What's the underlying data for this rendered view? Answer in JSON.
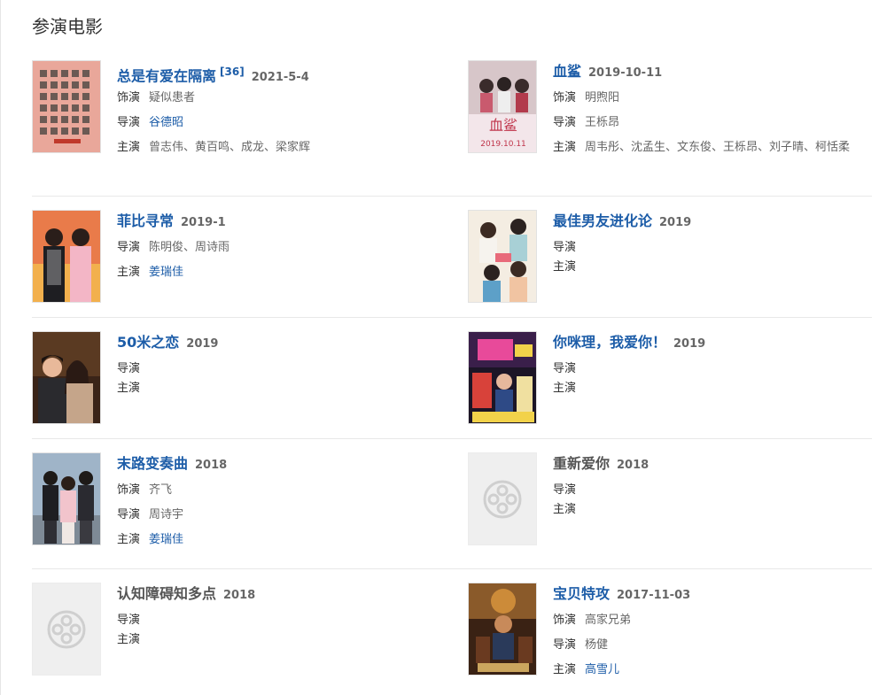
{
  "section": {
    "title": "参演电影"
  },
  "labels": {
    "role": "饰演",
    "director": "导演",
    "cast": "主演"
  },
  "films": [
    {
      "title": "总是有爱在隔离",
      "ref": "[36]",
      "date": "2021-5-4",
      "role": "疑似患者",
      "director": "谷德昭",
      "cast": "曾志伟、黄百鸣、成龙、梁家辉"
    },
    {
      "title": "血鲨",
      "date": "2019-10-11",
      "role": "明煦阳",
      "director": "王栎昂",
      "cast": "周韦彤、沈孟生、文东俊、王栎昂、刘子晴、柯恬柔"
    },
    {
      "title": "菲比寻常",
      "date": "2019-1",
      "director": "陈明俊、周诗雨",
      "cast": "姜瑞佳"
    },
    {
      "title": "最佳男友进化论",
      "date": "2019"
    },
    {
      "title": "50米之恋",
      "date": "2019"
    },
    {
      "title": "你咪理，我爱你！",
      "date": "2019"
    },
    {
      "title": "末路变奏曲",
      "date": "2018",
      "role": "齐飞",
      "director": "周诗宇",
      "cast": "姜瑞佳"
    },
    {
      "title": "重新爱你",
      "date": "2018"
    },
    {
      "title": "认知障碍知多点",
      "date": "2018"
    },
    {
      "title": "宝贝特攻",
      "date": "2017-11-03",
      "role": "高家兄弟",
      "director": "杨健",
      "cast": "高雪儿"
    }
  ],
  "posters": {
    "poster_text_1": "血鲨",
    "poster_text_2": "2019.10.11"
  }
}
